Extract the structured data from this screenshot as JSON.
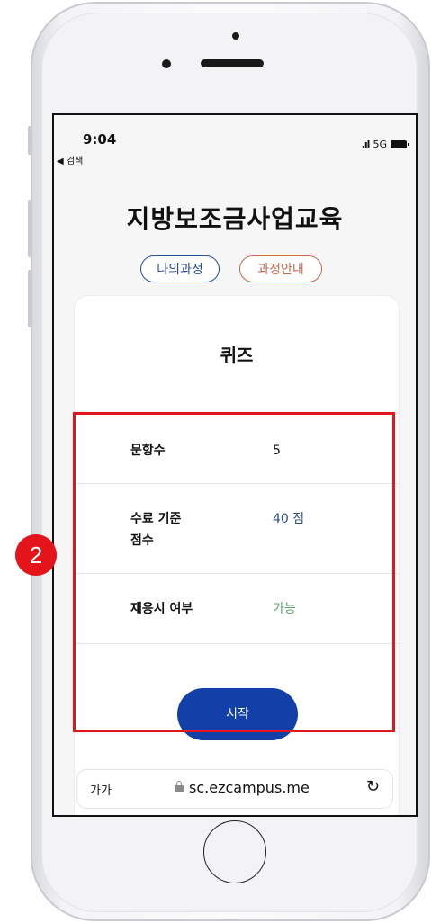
{
  "status": {
    "time": "9:04",
    "back_label": "◀ 검색",
    "network": "5G"
  },
  "app": {
    "title": "지방보조금사업교육"
  },
  "nav": {
    "my_course": "나의과정",
    "course_info": "과정안내"
  },
  "quiz": {
    "title": "퀴즈",
    "rows": [
      {
        "label": "문항수",
        "value": "5",
        "value_color": "#111111"
      },
      {
        "label_line1": "수료 기준",
        "label_line2": "점수",
        "value": "40 점",
        "value_color": "#2a4f8e"
      },
      {
        "label": "재응시 여부",
        "value": "가능",
        "value_color": "#5aa56a"
      }
    ],
    "start_label": "시작"
  },
  "browser": {
    "text_size": "가가",
    "url": "sc.ezcampus.me"
  },
  "annotation": {
    "step": "2"
  },
  "colors": {
    "accent_blue": "#123fa8",
    "highlight_red": "#e4141b",
    "pill_orange": "#c7684c"
  }
}
